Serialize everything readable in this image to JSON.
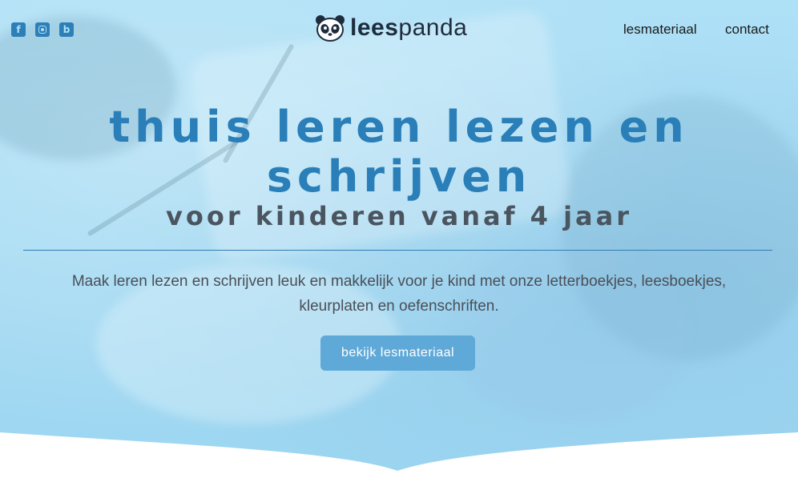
{
  "social": {
    "facebook_icon": "facebook-icon",
    "instagram_icon": "instagram-icon",
    "blog_icon": "blog-icon",
    "blog_letter": "b"
  },
  "logo": {
    "icon": "panda-icon",
    "text_bold": "lees",
    "text_regular": "panda"
  },
  "nav": {
    "items": [
      {
        "label": "lesmateriaal"
      },
      {
        "label": "contact"
      }
    ]
  },
  "hero": {
    "title": "thuis leren lezen en schrijven",
    "subtitle": "voor kinderen vanaf 4 jaar",
    "intro": "Maak leren lezen en schrijven leuk en makkelijk voor je kind met onze letterboekjes, leesboekjes, kleurplaten en oefenschriften.",
    "cta_label": "bekijk lesmateriaal"
  },
  "colors": {
    "hero_background": "#a6dbf3",
    "title": "#2a7fb8",
    "button": "#5fa9d9",
    "icons": "#2d7fb8"
  }
}
